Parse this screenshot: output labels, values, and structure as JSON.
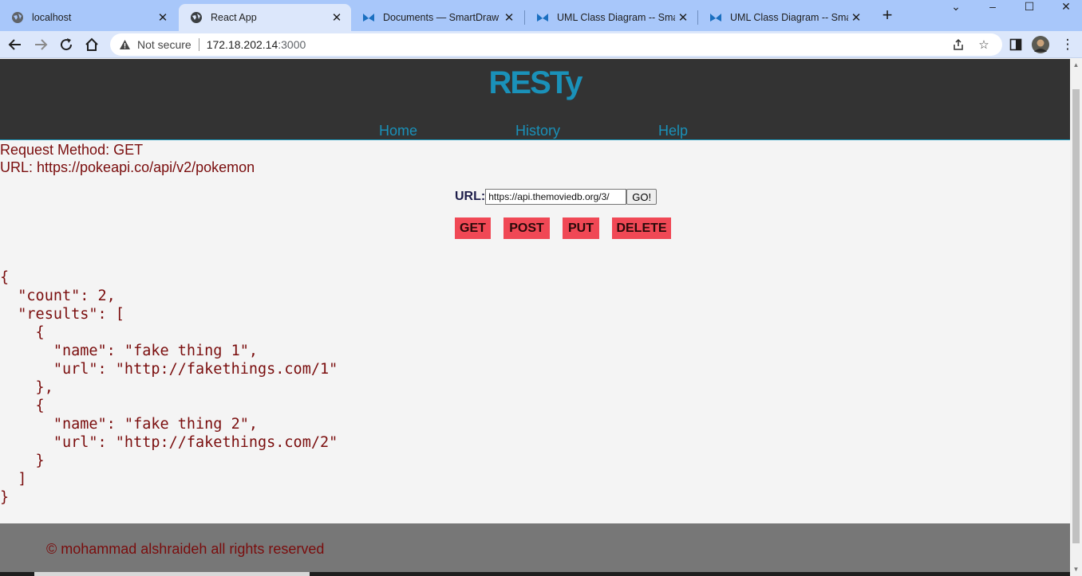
{
  "browser": {
    "tabs": [
      {
        "title": "localhost",
        "active": false
      },
      {
        "title": "React App",
        "active": true
      },
      {
        "title": "Documents — SmartDraw",
        "active": false
      },
      {
        "title": "UML Class Diagram -- Smart",
        "active": false
      },
      {
        "title": "UML Class Diagram -- Smart",
        "active": false
      }
    ],
    "address": {
      "security_label": "Not secure",
      "host": "172.18.202.14",
      "port": ":3000"
    }
  },
  "page": {
    "logo": "RESTy",
    "nav": [
      "Home",
      "History",
      "Help"
    ],
    "request": {
      "method_line": "Request Method: GET",
      "url_line": "URL: https://pokeapi.co/api/v2/pokemon"
    },
    "form": {
      "url_label": "URL:",
      "url_value": "https://api.themoviedb.org/3/",
      "go_label": "GO!"
    },
    "methods": [
      "GET",
      "POST",
      "PUT",
      "DELETE"
    ],
    "json_output": "{\n  \"count\": 2,\n  \"results\": [\n    {\n      \"name\": \"fake thing 1\",\n      \"url\": \"http://fakethings.com/1\"\n    },\n    {\n      \"name\": \"fake thing 2\",\n      \"url\": \"http://fakethings.com/2\"\n    }\n  ]\n}",
    "footer": "© mohammad alshraideh all rights reserved"
  },
  "colors": {
    "header_bg": "#333333",
    "accent": "#1a91b9",
    "text_dark_red": "#7a0d0d",
    "method_button": "#f04855",
    "footer_bg": "#777777"
  }
}
